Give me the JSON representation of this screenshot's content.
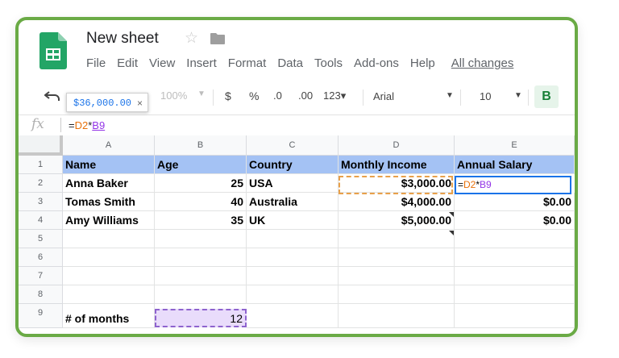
{
  "doc": {
    "title": "New sheet"
  },
  "menu": [
    "File",
    "Edit",
    "View",
    "Insert",
    "Format",
    "Data",
    "Tools",
    "Add-ons",
    "Help"
  ],
  "menu_allchanges": "All changes",
  "toolbar": {
    "tooltip_value": "$36,000.00",
    "tooltip_close": "×",
    "zoom": "100%",
    "currency": "$",
    "percent": "%",
    "dec_decrease": ".0",
    "dec_increase": ".00",
    "more_formats": "123",
    "font": "Arial",
    "font_size": "10",
    "bold": "B"
  },
  "formula_bar": {
    "fx": "fx",
    "eq": "=",
    "ref1": "D2",
    "op": "*",
    "ref2": "B9"
  },
  "columns": [
    "A",
    "B",
    "C",
    "D",
    "E"
  ],
  "rows": [
    "1",
    "2",
    "3",
    "4",
    "5",
    "6",
    "7",
    "8",
    "9"
  ],
  "cells": {
    "A1": "Name",
    "B1": "Age",
    "C1": "Country",
    "D1": "Monthly Income",
    "E1": "Annual Salary",
    "A2": "Anna Baker",
    "B2": "25",
    "C2": "USA",
    "D2": "$3,000.00",
    "A3": "Tomas Smith",
    "B3": "40",
    "C3": "Australia",
    "D3": "$4,000.00",
    "E3": "$0.00",
    "A4": "Amy Williams",
    "B4": "35",
    "C4": "UK",
    "D4": "$5,000.00",
    "E4": "$0.00",
    "A9": "# of months",
    "B9": "12"
  },
  "colors": {
    "frame": "#6aaa45",
    "header_fill": "#a4c2f4",
    "ref_d2": "#e8710a",
    "ref_b9": "#9334e6",
    "select": "#1a73e8"
  }
}
